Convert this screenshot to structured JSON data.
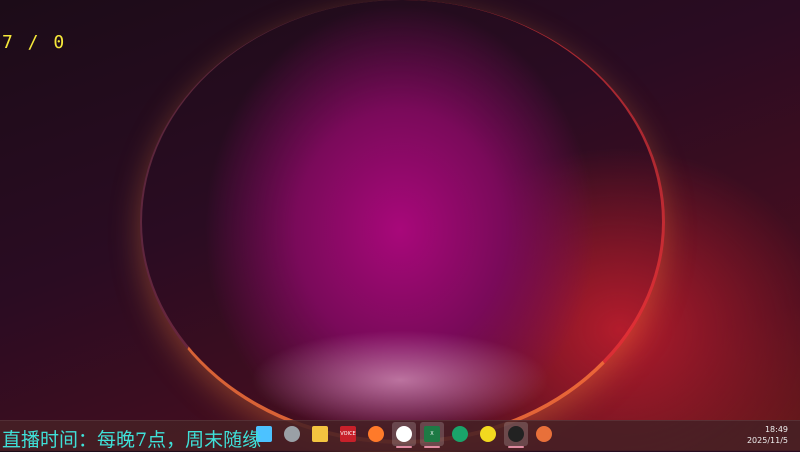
{
  "overlay": {
    "counter": "7 / 0",
    "banner": "直播时间：每晚7点，周末随缘"
  },
  "taskbar": {
    "apps": [
      {
        "name": "start-icon",
        "color": "#4cc2ff",
        "active": false
      },
      {
        "name": "app-hex-icon",
        "color": "#9aa0a6",
        "active": false
      },
      {
        "name": "file-explorer-icon",
        "color": "#f3c440",
        "active": false
      },
      {
        "name": "voicemeeter-icon",
        "label": "VOICE",
        "color": "#c8202a",
        "active": false
      },
      {
        "name": "chrome-like-icon",
        "color": "#ff7a2a",
        "active": false
      },
      {
        "name": "qq-icon",
        "color": "#ffffff",
        "active": true
      },
      {
        "name": "excel-icon",
        "label": "X",
        "color": "#1d7a45",
        "active": true
      },
      {
        "name": "green-app-icon",
        "color": "#1aa36a",
        "active": false
      },
      {
        "name": "music-app-icon",
        "color": "#f2d91f",
        "active": false
      },
      {
        "name": "obs-icon",
        "color": "#222222",
        "active": true
      },
      {
        "name": "colorful-app-icon",
        "color": "#e8703a",
        "active": false
      }
    ],
    "time": "18:49",
    "date": "2025/11/5"
  }
}
